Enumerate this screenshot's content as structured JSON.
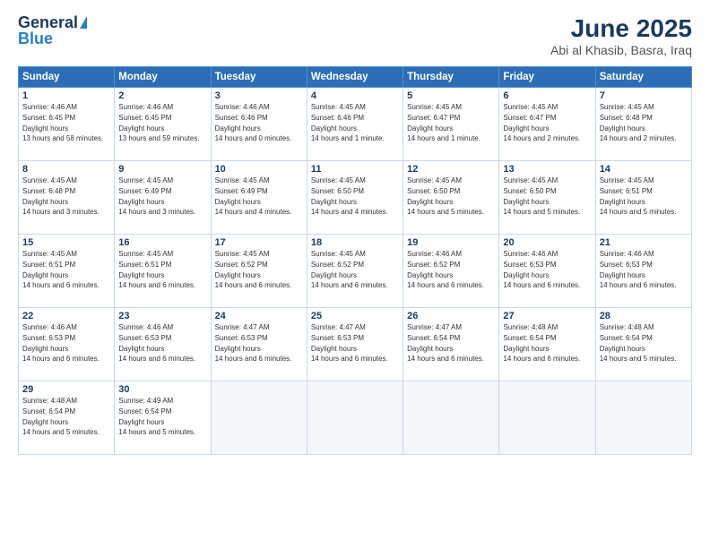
{
  "header": {
    "logo_general": "General",
    "logo_blue": "Blue",
    "title": "June 2025",
    "subtitle": "Abi al Khasib, Basra, Iraq"
  },
  "days_of_week": [
    "Sunday",
    "Monday",
    "Tuesday",
    "Wednesday",
    "Thursday",
    "Friday",
    "Saturday"
  ],
  "weeks": [
    [
      {
        "day": 1,
        "sunrise": "4:46 AM",
        "sunset": "6:45 PM",
        "daylight": "13 hours and 58 minutes."
      },
      {
        "day": 2,
        "sunrise": "4:46 AM",
        "sunset": "6:45 PM",
        "daylight": "13 hours and 59 minutes."
      },
      {
        "day": 3,
        "sunrise": "4:46 AM",
        "sunset": "6:46 PM",
        "daylight": "14 hours and 0 minutes."
      },
      {
        "day": 4,
        "sunrise": "4:45 AM",
        "sunset": "6:46 PM",
        "daylight": "14 hours and 1 minute."
      },
      {
        "day": 5,
        "sunrise": "4:45 AM",
        "sunset": "6:47 PM",
        "daylight": "14 hours and 1 minute."
      },
      {
        "day": 6,
        "sunrise": "4:45 AM",
        "sunset": "6:47 PM",
        "daylight": "14 hours and 2 minutes."
      },
      {
        "day": 7,
        "sunrise": "4:45 AM",
        "sunset": "6:48 PM",
        "daylight": "14 hours and 2 minutes."
      }
    ],
    [
      {
        "day": 8,
        "sunrise": "4:45 AM",
        "sunset": "6:48 PM",
        "daylight": "14 hours and 3 minutes."
      },
      {
        "day": 9,
        "sunrise": "4:45 AM",
        "sunset": "6:49 PM",
        "daylight": "14 hours and 3 minutes."
      },
      {
        "day": 10,
        "sunrise": "4:45 AM",
        "sunset": "6:49 PM",
        "daylight": "14 hours and 4 minutes."
      },
      {
        "day": 11,
        "sunrise": "4:45 AM",
        "sunset": "6:50 PM",
        "daylight": "14 hours and 4 minutes."
      },
      {
        "day": 12,
        "sunrise": "4:45 AM",
        "sunset": "6:50 PM",
        "daylight": "14 hours and 5 minutes."
      },
      {
        "day": 13,
        "sunrise": "4:45 AM",
        "sunset": "6:50 PM",
        "daylight": "14 hours and 5 minutes."
      },
      {
        "day": 14,
        "sunrise": "4:45 AM",
        "sunset": "6:51 PM",
        "daylight": "14 hours and 5 minutes."
      }
    ],
    [
      {
        "day": 15,
        "sunrise": "4:45 AM",
        "sunset": "6:51 PM",
        "daylight": "14 hours and 6 minutes."
      },
      {
        "day": 16,
        "sunrise": "4:45 AM",
        "sunset": "6:51 PM",
        "daylight": "14 hours and 6 minutes."
      },
      {
        "day": 17,
        "sunrise": "4:45 AM",
        "sunset": "6:52 PM",
        "daylight": "14 hours and 6 minutes."
      },
      {
        "day": 18,
        "sunrise": "4:45 AM",
        "sunset": "6:52 PM",
        "daylight": "14 hours and 6 minutes."
      },
      {
        "day": 19,
        "sunrise": "4:46 AM",
        "sunset": "6:52 PM",
        "daylight": "14 hours and 6 minutes."
      },
      {
        "day": 20,
        "sunrise": "4:46 AM",
        "sunset": "6:53 PM",
        "daylight": "14 hours and 6 minutes."
      },
      {
        "day": 21,
        "sunrise": "4:46 AM",
        "sunset": "6:53 PM",
        "daylight": "14 hours and 6 minutes."
      }
    ],
    [
      {
        "day": 22,
        "sunrise": "4:46 AM",
        "sunset": "6:53 PM",
        "daylight": "14 hours and 6 minutes."
      },
      {
        "day": 23,
        "sunrise": "4:46 AM",
        "sunset": "6:53 PM",
        "daylight": "14 hours and 6 minutes."
      },
      {
        "day": 24,
        "sunrise": "4:47 AM",
        "sunset": "6:53 PM",
        "daylight": "14 hours and 6 minutes."
      },
      {
        "day": 25,
        "sunrise": "4:47 AM",
        "sunset": "6:53 PM",
        "daylight": "14 hours and 6 minutes."
      },
      {
        "day": 26,
        "sunrise": "4:47 AM",
        "sunset": "6:54 PM",
        "daylight": "14 hours and 6 minutes."
      },
      {
        "day": 27,
        "sunrise": "4:48 AM",
        "sunset": "6:54 PM",
        "daylight": "14 hours and 6 minutes."
      },
      {
        "day": 28,
        "sunrise": "4:48 AM",
        "sunset": "6:54 PM",
        "daylight": "14 hours and 5 minutes."
      }
    ],
    [
      {
        "day": 29,
        "sunrise": "4:48 AM",
        "sunset": "6:54 PM",
        "daylight": "14 hours and 5 minutes."
      },
      {
        "day": 30,
        "sunrise": "4:49 AM",
        "sunset": "6:54 PM",
        "daylight": "14 hours and 5 minutes."
      },
      null,
      null,
      null,
      null,
      null
    ]
  ]
}
